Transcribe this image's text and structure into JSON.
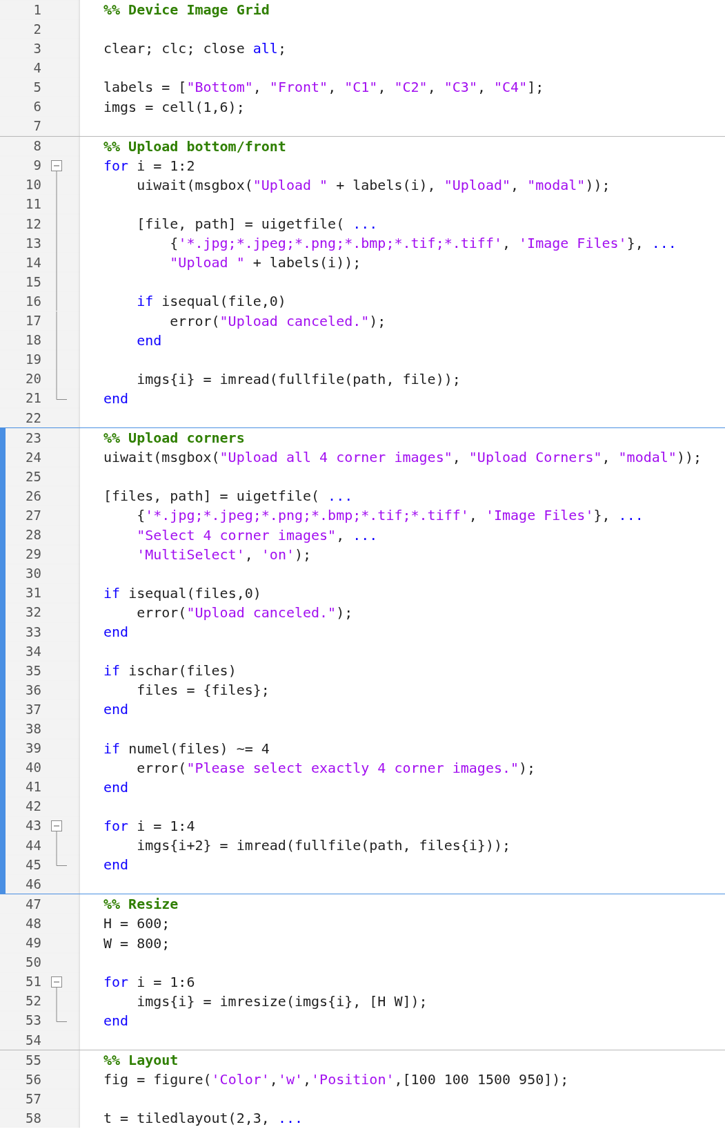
{
  "editor": {
    "sections": [
      {
        "active": false,
        "lines": [
          {
            "number": "1",
            "kind": "plain",
            "tokens": [
              {
                "kind": "comment",
                "text": "%% Device Image Grid"
              }
            ]
          },
          {
            "number": "2",
            "kind": "plain"
          },
          {
            "number": "3",
            "kind": "plain",
            "tokens": [
              {
                "kind": "plain",
                "text": "clear; clc; close "
              },
              {
                "kind": "keyword",
                "text": "all"
              },
              {
                "kind": "plain",
                "text": ";"
              }
            ]
          },
          {
            "number": "4",
            "kind": "plain"
          },
          {
            "number": "5",
            "kind": "plain",
            "tokens": [
              {
                "kind": "plain",
                "text": "labels = ["
              },
              {
                "kind": "string",
                "text": "\"Bottom\""
              },
              {
                "kind": "plain",
                "text": ", "
              },
              {
                "kind": "string",
                "text": "\"Front\""
              },
              {
                "kind": "plain",
                "text": ", "
              },
              {
                "kind": "string",
                "text": "\"C1\""
              },
              {
                "kind": "plain",
                "text": ", "
              },
              {
                "kind": "string",
                "text": "\"C2\""
              },
              {
                "kind": "plain",
                "text": ", "
              },
              {
                "kind": "string",
                "text": "\"C3\""
              },
              {
                "kind": "plain",
                "text": ", "
              },
              {
                "kind": "string",
                "text": "\"C4\""
              },
              {
                "kind": "plain",
                "text": "];"
              }
            ]
          },
          {
            "number": "6",
            "kind": "plain",
            "tokens": [
              {
                "kind": "plain",
                "text": "imgs = cell(1,6);"
              }
            ]
          },
          {
            "number": "7",
            "kind": "plain"
          }
        ]
      },
      {
        "active": false,
        "lines": [
          {
            "number": "8",
            "kind": "plain",
            "tokens": [
              {
                "kind": "comment",
                "text": "%% Upload bottom/front"
              }
            ]
          },
          {
            "number": "9",
            "kind": "fold_start",
            "tokens": [
              {
                "kind": "keyword",
                "text": "for"
              },
              {
                "kind": "plain",
                "text": " i = 1:2"
              }
            ]
          },
          {
            "number": "10",
            "kind": "fold_body",
            "tokens": [
              {
                "kind": "plain",
                "text": "    uiwait(msgbox("
              },
              {
                "kind": "string",
                "text": "\"Upload \""
              },
              {
                "kind": "plain",
                "text": " + labels(i), "
              },
              {
                "kind": "string",
                "text": "\"Upload\""
              },
              {
                "kind": "plain",
                "text": ", "
              },
              {
                "kind": "string",
                "text": "\"modal\""
              },
              {
                "kind": "plain",
                "text": "));"
              }
            ]
          },
          {
            "number": "11",
            "kind": "fold_body"
          },
          {
            "number": "12",
            "kind": "fold_body",
            "tokens": [
              {
                "kind": "plain",
                "text": "    [file, path] = uigetfile( "
              },
              {
                "kind": "keyword",
                "text": "..."
              }
            ]
          },
          {
            "number": "13",
            "kind": "fold_body",
            "tokens": [
              {
                "kind": "plain",
                "text": "        {"
              },
              {
                "kind": "string",
                "text": "'*.jpg;*.jpeg;*.png;*.bmp;*.tif;*.tiff'"
              },
              {
                "kind": "plain",
                "text": ", "
              },
              {
                "kind": "string",
                "text": "'Image Files'"
              },
              {
                "kind": "plain",
                "text": "}, "
              },
              {
                "kind": "keyword",
                "text": "..."
              }
            ]
          },
          {
            "number": "14",
            "kind": "fold_body",
            "tokens": [
              {
                "kind": "string",
                "text": "        \"Upload \""
              },
              {
                "kind": "plain",
                "text": " + labels(i));"
              }
            ]
          },
          {
            "number": "15",
            "kind": "fold_body"
          },
          {
            "number": "16",
            "kind": "fold_body",
            "tokens": [
              {
                "kind": "keyword",
                "text": "    if"
              },
              {
                "kind": "plain",
                "text": " isequal(file,0)"
              }
            ]
          },
          {
            "number": "17",
            "kind": "fold_body",
            "tokens": [
              {
                "kind": "plain",
                "text": "        error("
              },
              {
                "kind": "string",
                "text": "\"Upload canceled.\""
              },
              {
                "kind": "plain",
                "text": ");"
              }
            ]
          },
          {
            "number": "18",
            "kind": "fold_body",
            "tokens": [
              {
                "kind": "keyword",
                "text": "    end"
              }
            ]
          },
          {
            "number": "19",
            "kind": "fold_body"
          },
          {
            "number": "20",
            "kind": "fold_body",
            "tokens": [
              {
                "kind": "plain",
                "text": "    imgs{i} = imread(fullfile(path, file));"
              }
            ]
          },
          {
            "number": "21",
            "kind": "fold_end",
            "tokens": [
              {
                "kind": "keyword",
                "text": "end"
              }
            ]
          },
          {
            "number": "22",
            "kind": "plain"
          }
        ]
      },
      {
        "active": true,
        "lines": [
          {
            "number": "23",
            "kind": "plain",
            "tokens": [
              {
                "kind": "comment",
                "text": "%% Upload corners"
              }
            ]
          },
          {
            "number": "24",
            "kind": "plain",
            "tokens": [
              {
                "kind": "plain",
                "text": "uiwait(msgbox("
              },
              {
                "kind": "string",
                "text": "\"Upload all 4 corner images\""
              },
              {
                "kind": "plain",
                "text": ", "
              },
              {
                "kind": "string",
                "text": "\"Upload Corners\""
              },
              {
                "kind": "plain",
                "text": ", "
              },
              {
                "kind": "string",
                "text": "\"modal\""
              },
              {
                "kind": "plain",
                "text": "));"
              }
            ]
          },
          {
            "number": "25",
            "kind": "plain"
          },
          {
            "number": "26",
            "kind": "plain",
            "tokens": [
              {
                "kind": "plain",
                "text": "[files, path] = uigetfile( "
              },
              {
                "kind": "keyword",
                "text": "..."
              }
            ]
          },
          {
            "number": "27",
            "kind": "plain",
            "tokens": [
              {
                "kind": "plain",
                "text": "    {"
              },
              {
                "kind": "string",
                "text": "'*.jpg;*.jpeg;*.png;*.bmp;*.tif;*.tiff'"
              },
              {
                "kind": "plain",
                "text": ", "
              },
              {
                "kind": "string",
                "text": "'Image Files'"
              },
              {
                "kind": "plain",
                "text": "}, "
              },
              {
                "kind": "keyword",
                "text": "..."
              }
            ]
          },
          {
            "number": "28",
            "kind": "plain",
            "tokens": [
              {
                "kind": "string",
                "text": "    \"Select 4 corner images\""
              },
              {
                "kind": "plain",
                "text": ", "
              },
              {
                "kind": "keyword",
                "text": "..."
              }
            ]
          },
          {
            "number": "29",
            "kind": "plain",
            "tokens": [
              {
                "kind": "string",
                "text": "    'MultiSelect'"
              },
              {
                "kind": "plain",
                "text": ", "
              },
              {
                "kind": "string",
                "text": "'on'"
              },
              {
                "kind": "plain",
                "text": ");"
              }
            ]
          },
          {
            "number": "30",
            "kind": "plain"
          },
          {
            "number": "31",
            "kind": "plain",
            "tokens": [
              {
                "kind": "keyword",
                "text": "if"
              },
              {
                "kind": "plain",
                "text": " isequal(files,0)"
              }
            ]
          },
          {
            "number": "32",
            "kind": "plain",
            "tokens": [
              {
                "kind": "plain",
                "text": "    error("
              },
              {
                "kind": "string",
                "text": "\"Upload canceled.\""
              },
              {
                "kind": "plain",
                "text": ");"
              }
            ]
          },
          {
            "number": "33",
            "kind": "plain",
            "tokens": [
              {
                "kind": "keyword",
                "text": "end"
              }
            ]
          },
          {
            "number": "34",
            "kind": "plain"
          },
          {
            "number": "35",
            "kind": "plain",
            "tokens": [
              {
                "kind": "keyword",
                "text": "if"
              },
              {
                "kind": "plain",
                "text": " ischar(files)"
              }
            ]
          },
          {
            "number": "36",
            "kind": "plain",
            "tokens": [
              {
                "kind": "plain",
                "text": "    files = {files};"
              }
            ]
          },
          {
            "number": "37",
            "kind": "plain",
            "tokens": [
              {
                "kind": "keyword",
                "text": "end"
              }
            ]
          },
          {
            "number": "38",
            "kind": "plain"
          },
          {
            "number": "39",
            "kind": "plain",
            "tokens": [
              {
                "kind": "keyword",
                "text": "if"
              },
              {
                "kind": "plain",
                "text": " numel(files) ~= 4"
              }
            ]
          },
          {
            "number": "40",
            "kind": "plain",
            "tokens": [
              {
                "kind": "plain",
                "text": "    error("
              },
              {
                "kind": "string",
                "text": "\"Please select exactly 4 corner images.\""
              },
              {
                "kind": "plain",
                "text": ");"
              }
            ]
          },
          {
            "number": "41",
            "kind": "plain",
            "tokens": [
              {
                "kind": "keyword",
                "text": "end"
              }
            ]
          },
          {
            "number": "42",
            "kind": "plain"
          },
          {
            "number": "43",
            "kind": "fold_start",
            "tokens": [
              {
                "kind": "keyword",
                "text": "for"
              },
              {
                "kind": "plain",
                "text": " i = 1:4"
              }
            ]
          },
          {
            "number": "44",
            "kind": "fold_body",
            "tokens": [
              {
                "kind": "plain",
                "text": "    imgs{i+2} = imread(fullfile(path, files{i}));"
              }
            ]
          },
          {
            "number": "45",
            "kind": "fold_end",
            "tokens": [
              {
                "kind": "keyword",
                "text": "end"
              }
            ]
          },
          {
            "number": "46",
            "kind": "plain"
          }
        ]
      },
      {
        "active": false,
        "lines": [
          {
            "number": "47",
            "kind": "plain",
            "tokens": [
              {
                "kind": "comment",
                "text": "%% Resize"
              }
            ]
          },
          {
            "number": "48",
            "kind": "plain",
            "tokens": [
              {
                "kind": "plain",
                "text": "H = 600;"
              }
            ]
          },
          {
            "number": "49",
            "kind": "plain",
            "tokens": [
              {
                "kind": "plain",
                "text": "W = 800;"
              }
            ]
          },
          {
            "number": "50",
            "kind": "plain"
          },
          {
            "number": "51",
            "kind": "fold_start",
            "tokens": [
              {
                "kind": "keyword",
                "text": "for"
              },
              {
                "kind": "plain",
                "text": " i = 1:6"
              }
            ]
          },
          {
            "number": "52",
            "kind": "fold_body",
            "tokens": [
              {
                "kind": "plain",
                "text": "    imgs{i} = imresize(imgs{i}, [H W]);"
              }
            ]
          },
          {
            "number": "53",
            "kind": "fold_end",
            "tokens": [
              {
                "kind": "keyword",
                "text": "end"
              }
            ]
          },
          {
            "number": "54",
            "kind": "plain"
          }
        ]
      },
      {
        "active": false,
        "lines": [
          {
            "number": "55",
            "kind": "plain",
            "tokens": [
              {
                "kind": "comment",
                "text": "%% Layout"
              }
            ]
          },
          {
            "number": "56",
            "kind": "plain",
            "tokens": [
              {
                "kind": "plain",
                "text": "fig = figure("
              },
              {
                "kind": "string",
                "text": "'Color'"
              },
              {
                "kind": "plain",
                "text": ","
              },
              {
                "kind": "string",
                "text": "'w'"
              },
              {
                "kind": "plain",
                "text": ","
              },
              {
                "kind": "string",
                "text": "'Position'"
              },
              {
                "kind": "plain",
                "text": ",[100 100 1500 950]);"
              }
            ]
          },
          {
            "number": "57",
            "kind": "plain"
          },
          {
            "number": "58",
            "kind": "plain",
            "tokens": [
              {
                "kind": "plain",
                "text": "t = tiledlayout(2,3, "
              },
              {
                "kind": "keyword",
                "text": "..."
              }
            ]
          }
        ]
      }
    ]
  }
}
